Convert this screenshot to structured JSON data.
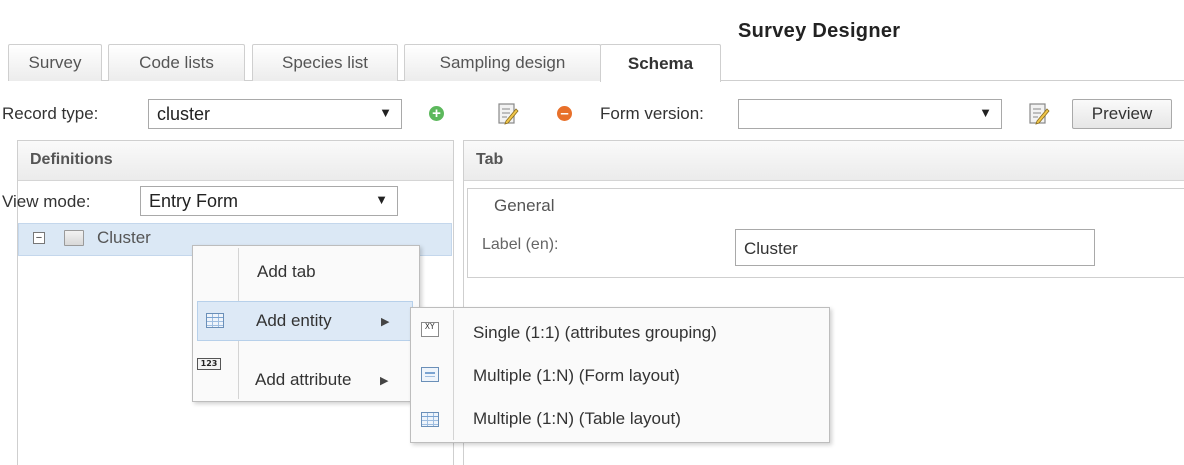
{
  "app": {
    "title": "Survey Designer"
  },
  "tabs": [
    {
      "label": "Survey"
    },
    {
      "label": "Code lists"
    },
    {
      "label": "Species list"
    },
    {
      "label": "Sampling design"
    },
    {
      "label": "Schema",
      "active": true
    }
  ],
  "toolbar": {
    "record_type_label": "Record type:",
    "record_type_value": "cluster",
    "form_version_label": "Form version:",
    "form_version_value": "",
    "preview_label": "Preview",
    "add_icon": "add-circle-icon",
    "edit_icon": "edit-icon",
    "remove_icon": "remove-circle-icon"
  },
  "definitions": {
    "header": "Definitions",
    "view_mode_label": "View mode:",
    "view_mode_value": "Entry Form",
    "tree": [
      {
        "label": "Cluster",
        "expanded": true,
        "toggle": "⊟"
      }
    ]
  },
  "detail": {
    "header": "Tab",
    "section_legend": "General",
    "label_field_label": "Label (en):",
    "label_field_value": "Cluster"
  },
  "context_menu": {
    "items": [
      {
        "label": "Add tab",
        "icon": ""
      },
      {
        "label": "Add entity",
        "icon": "table-icon",
        "submenu": true,
        "hovered": true
      },
      {
        "label": "Add attribute",
        "icon": "number-icon",
        "submenu": true
      }
    ],
    "submenu_arrow": "▶"
  },
  "entity_submenu": {
    "items": [
      {
        "label": "Single (1:1) (attributes grouping)",
        "icon": "xy-icon",
        "icon_text": "XY"
      },
      {
        "label": "Multiple (1:N) (Form layout)",
        "icon": "form-icon"
      },
      {
        "label": "Multiple (1:N) (Table layout)",
        "icon": "table-icon"
      }
    ]
  },
  "attribute_icon_text": "123",
  "dropdown_arrow": "▼",
  "colors": {
    "selection": "#dbe8f5",
    "add": "#5cb85c",
    "remove": "#e8702a"
  }
}
